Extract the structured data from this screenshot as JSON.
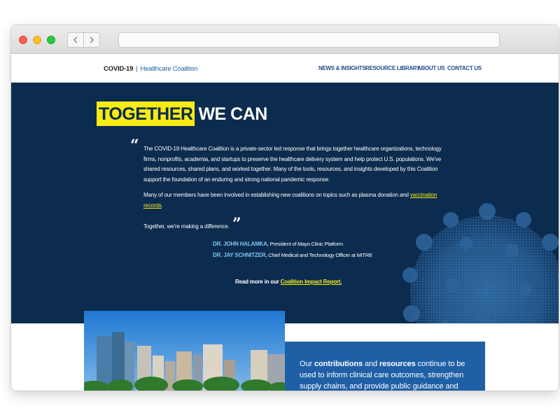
{
  "browser": {
    "back_icon": "chevron-left-icon",
    "forward_icon": "chevron-right-icon",
    "url": ""
  },
  "header": {
    "brand_primary": "COVID-19",
    "brand_separator": "|",
    "brand_secondary": "Healthcare Coalition",
    "nav": [
      "NEWS & INSIGHTS",
      "RESOURCE LIBRARY",
      "ABOUT US",
      "CONTACT US"
    ]
  },
  "hero": {
    "title_highlight": "TOGETHER",
    "title_rest": "WE CAN",
    "quote_open": "“",
    "quote_close": "”",
    "paragraph1": "The COVID-19 Healthcare Coalition is a private-sector led response that brings together healthcare organizations, technology firms, nonprofits, academia, and startups to preserve the healthcare delivery system and help protect U.S. populations. We've shared resources, shared plans, and worked together. Many of the tools, resources, and insights developed by this Coalition support the foundation of an enduring and strong national pandemic response.",
    "paragraph2_text": "Many of our members have been involved in establishing new coalitions on topics such as plasma donation and ",
    "paragraph2_link": "vaccination records",
    "paragraph2_end": ".",
    "paragraph3": "Together, we're making a difference.",
    "attributions": [
      {
        "name": "DR. JOHN HALAMKA,",
        "title": " President of Mayo Clinic Platform"
      },
      {
        "name": "DR. JAY SCHNITZER,",
        "title": " Chief Medical and Technology Officer at MITRE"
      }
    ],
    "readmore_text": "Read more in our ",
    "readmore_link": "Coalition Impact Report.",
    "accent_yellow": "#f6eb14",
    "navy": "#0c2c4f"
  },
  "contributions": {
    "text_pre": "Our ",
    "bold1": "contributions",
    "text_mid": " and ",
    "bold2": "resources",
    "text_post": " continue to be used to inform clinical care outcomes, strengthen supply chains, and provide public guidance and",
    "card_color": "#1f5fa6"
  }
}
